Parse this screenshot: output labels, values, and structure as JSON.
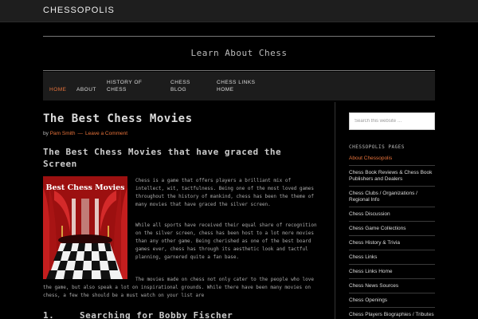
{
  "site": {
    "title": "CHESSOPOLIS",
    "tagline": "Learn About Chess"
  },
  "nav": {
    "items": [
      {
        "label": "HOME",
        "active": true
      },
      {
        "label": "ABOUT"
      },
      {
        "label_line1": "HISTORY OF",
        "label_line2": "CHESS"
      },
      {
        "label_line1": "CHESS",
        "label_line2": "BLOG"
      },
      {
        "label_line1": "CHESS LINKS",
        "label_line2": "HOME"
      }
    ]
  },
  "post": {
    "title": "The Best Chess Movies",
    "byline": {
      "prefix": "by",
      "author": "Pam Smith",
      "separator": "—",
      "comment_link": "Leave a Comment"
    },
    "subheading": "The Best Chess Movies that have graced the Screen",
    "image": {
      "caption": "Best Chess Movies"
    },
    "paragraphs": [
      "Chess is a game that offers players a brilliant mix of intellect, wit, tactfulness. Being one of the most loved games throughout the history of mankind, chess has been the theme of many movies that have graced the silver screen.",
      "While all sports have received their equal share of recognition on the silver screen, chess has been host to a lot more movies than any other game. Being cherished as one of the best board games ever, chess has through its aesthetic look and tactful planning, garnered quite a fan base.",
      "The movies made on chess not only cater to the people who love the game, but also speak a lot on inspirational grounds. While there have been many movies on chess, a few the should be a must watch on your list are"
    ],
    "list_heading": {
      "number": "1.",
      "text": "Searching for Bobby Fischer"
    }
  },
  "sidebar": {
    "search_placeholder": "Search this website …",
    "widget_title": "CHESSOPOLIS PAGES",
    "pages": [
      "About Chessopolis",
      "Chess Book Reviews & Chess Book Publishers and Dealers",
      "Chess Clubs / Organizations / Regional Info",
      "Chess Discussion",
      "Chess Game Collections",
      "Chess History & Trivia",
      "Chess Links",
      "Chess Links Home",
      "Chess News Sources",
      "Chess Openings",
      "Chess Players Biographies / Tributes"
    ]
  },
  "colors": {
    "accent": "#e8733b",
    "background": "#000000",
    "bar": "#1e1e1e"
  }
}
